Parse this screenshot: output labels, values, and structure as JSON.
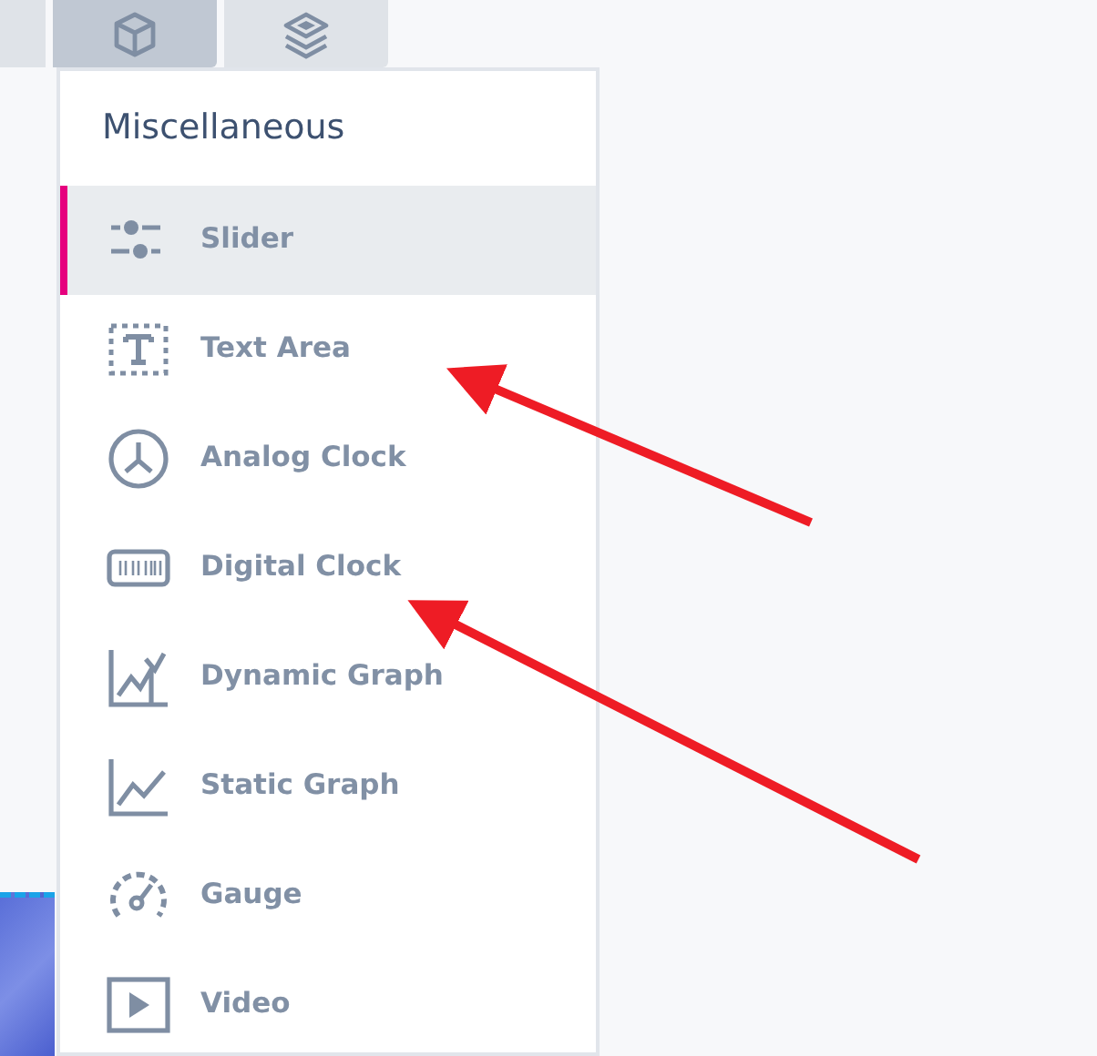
{
  "toolbar_tabs": [
    {
      "kind": "cube",
      "selected": true
    },
    {
      "kind": "layers",
      "selected": false
    }
  ],
  "menu": {
    "title": "Miscellaneous",
    "items": [
      {
        "kind": "slider",
        "label": "Slider",
        "selected": true
      },
      {
        "kind": "textarea",
        "label": "Text Area",
        "selected": false
      },
      {
        "kind": "analog",
        "label": "Analog Clock",
        "selected": false
      },
      {
        "kind": "digital",
        "label": "Digital Clock",
        "selected": false
      },
      {
        "kind": "dyngraph",
        "label": "Dynamic Graph",
        "selected": false
      },
      {
        "kind": "staticgraph",
        "label": "Static Graph",
        "selected": false
      },
      {
        "kind": "gauge",
        "label": "Gauge",
        "selected": false
      },
      {
        "kind": "video",
        "label": "Video",
        "selected": false
      }
    ]
  }
}
